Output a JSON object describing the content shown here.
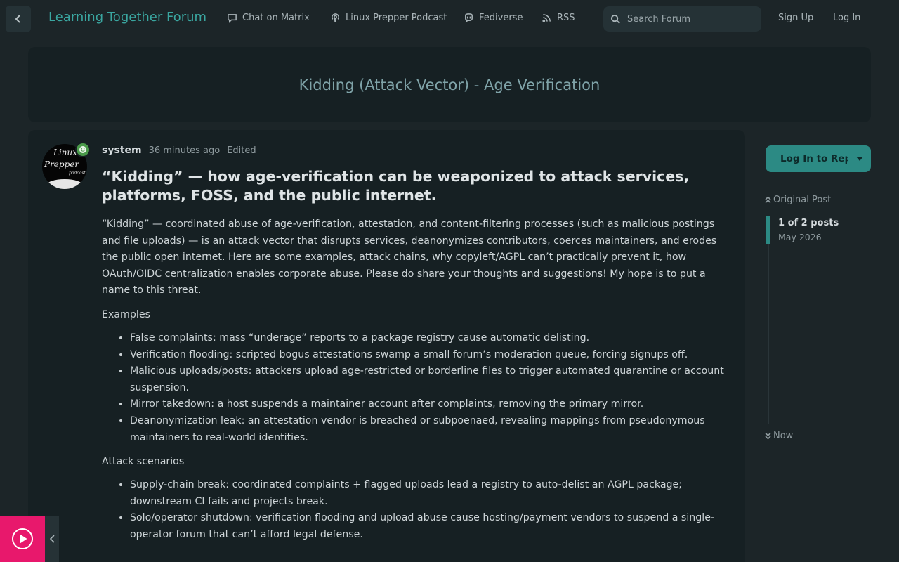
{
  "header": {
    "site_title": "Learning Together Forum",
    "nav": [
      {
        "label": "Chat on Matrix",
        "icon": "chat-icon"
      },
      {
        "label": "Linux Prepper Podcast",
        "icon": "podcast-icon"
      },
      {
        "label": "Fediverse",
        "icon": "mastodon-icon"
      },
      {
        "label": "RSS",
        "icon": "rss-icon"
      }
    ],
    "search_placeholder": "Search Forum",
    "sign_up": "Sign Up",
    "log_in": "Log In"
  },
  "topic": {
    "title": "Kidding (Attack Vector) - Age Verification"
  },
  "post": {
    "avatar_text": {
      "line1": "Linux",
      "line2": "Prepper",
      "line3": "podcast"
    },
    "username": "system",
    "time": "36 minutes ago",
    "edited": "Edited",
    "heading": "“Kidding” — how age-verification can be weaponized to attack services, platforms, FOSS, and the public internet.",
    "intro": "“Kidding” — coordinated abuse of age-verification, attestation, and content-filtering processes (such as malicious postings and file uploads) — is an attack vector that disrupts services, deanonymizes contributors, coerces maintainers, and erodes the public open internet. Here are some examples, attack chains, why copyleft/AGPL can’t practically prevent it, how OAuth/OIDC centralization enables corporate abuse. Please do share your thoughts and suggestions! My hope is to put a name to this threat.",
    "examples_label": "Examples",
    "examples": [
      "False complaints: mass “underage” reports to a package registry cause automatic delisting.",
      "Verification flooding: scripted bogus attestations swamp a small forum’s moderation queue, forcing signups off.",
      "Malicious uploads/posts: attackers upload age-restricted or borderline files to trigger automated quarantine or account suspension.",
      "Mirror takedown: a host suspends a maintainer account after complaints, removing the primary mirror.",
      "Deanonymization leak: an attestation vendor is breached or subpoenaed, revealing mappings from pseudonymous maintainers to real-world identities."
    ],
    "scenarios_label": "Attack scenarios",
    "scenarios": [
      "Supply-chain break: coordinated complaints + flagged uploads lead a registry to auto-delist an AGPL package; downstream CI fails and projects break.",
      "Solo/operator shutdown: verification flooding and upload abuse cause hosting/payment vendors to suspend a single-operator forum that can’t afford legal defense."
    ]
  },
  "sidebar": {
    "reply_label": "Log In to Reply",
    "timeline_top": "Original Post",
    "timeline_count": "1 of 2 posts",
    "timeline_date": "May 2026",
    "timeline_bottom": "Now",
    "progress_fraction": 0.5
  },
  "colors": {
    "accent": "#2c8a84",
    "title": "#3aa6a0",
    "player": "#e8186c"
  }
}
